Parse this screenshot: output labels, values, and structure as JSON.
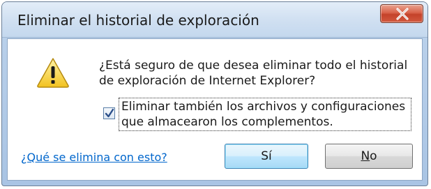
{
  "dialog": {
    "title": "Eliminar el historial de exploración",
    "close_icon": "close-icon",
    "warning_icon": "warning-icon",
    "message_lines": [
      "¿Está seguro de que desea eliminar todo el historial",
      "de exploración de Internet Explorer?"
    ],
    "checkbox": {
      "checked": true,
      "label_lines": [
        "Eliminar también los archivos y configuraciones",
        "que almacearon los complementos."
      ]
    },
    "help_link": "¿Qué se elimina con esto?",
    "buttons": {
      "yes": "Sí",
      "no_mnemonic": "N",
      "no_rest": "o"
    }
  },
  "colors": {
    "close_button": "#d9634a",
    "link": "#0066cc",
    "warning_fill": "#f7d94a",
    "default_button_border": "#3c7fb1"
  }
}
